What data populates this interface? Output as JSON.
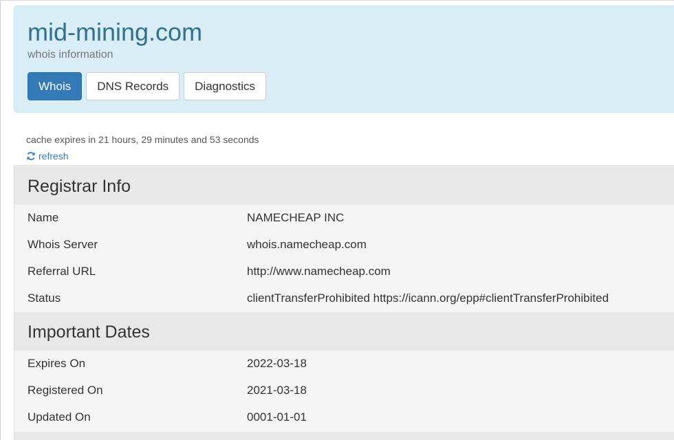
{
  "header": {
    "domain": "mid-mining.com",
    "subtitle": "whois information",
    "tabs": [
      {
        "label": "Whois",
        "active": true
      },
      {
        "label": "DNS Records",
        "active": false
      },
      {
        "label": "Diagnostics",
        "active": false
      }
    ]
  },
  "cache": {
    "note": "cache expires in 21 hours, 29 minutes and 53 seconds",
    "refresh_label": "refresh",
    "refresh_icon": "refresh-icon"
  },
  "registrar": {
    "title": "Registrar Info",
    "rows": [
      {
        "label": "Name",
        "value": "NAMECHEAP INC"
      },
      {
        "label": "Whois Server",
        "value": "whois.namecheap.com"
      },
      {
        "label": "Referral URL",
        "value": "http://www.namecheap.com"
      },
      {
        "label": "Status",
        "value": "clientTransferProhibited https://icann.org/epp#clientTransferProhibited"
      }
    ]
  },
  "dates": {
    "title": "Important Dates",
    "rows": [
      {
        "label": "Expires On",
        "value": "2022-03-18"
      },
      {
        "label": "Registered On",
        "value": "2021-03-18"
      },
      {
        "label": "Updated On",
        "value": "0001-01-01"
      }
    ]
  },
  "colors": {
    "accent": "#337ab7",
    "header_bg": "#d9edf7",
    "title": "#31708f"
  }
}
